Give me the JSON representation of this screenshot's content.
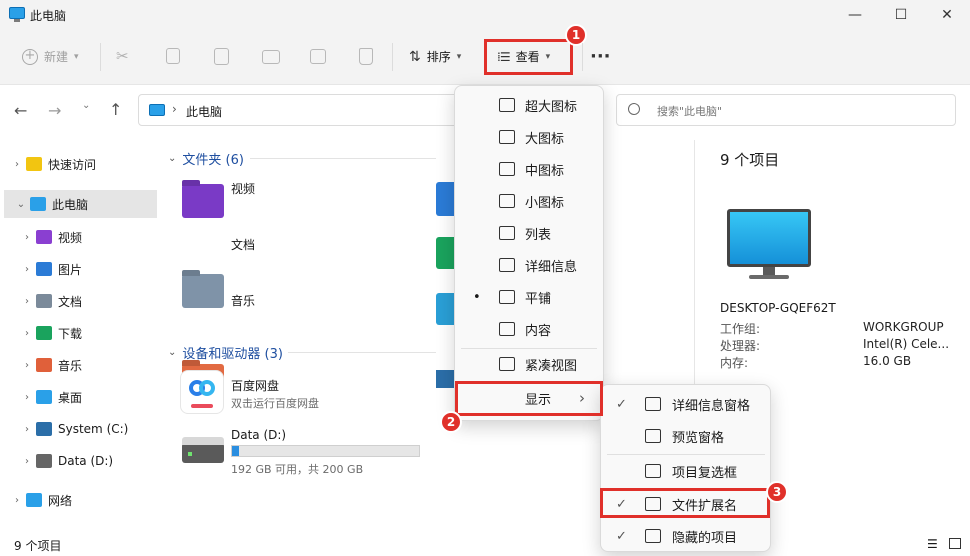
{
  "window": {
    "title": "此电脑",
    "minimize": "—",
    "maximize": "☐",
    "close": "✕"
  },
  "toolbar": {
    "new": "新建",
    "sort": "排序",
    "view": "查看",
    "more": "···"
  },
  "address": {
    "path": "此电脑",
    "search_placeholder": "搜索\"此电脑\""
  },
  "badges": {
    "one": "1",
    "two": "2",
    "three": "3"
  },
  "sidebar": [
    {
      "label": "快速访问",
      "icon": "star-icon",
      "color": "#f2c511"
    },
    {
      "label": "此电脑",
      "icon": "computer-icon",
      "color": "#2aa0e8"
    },
    {
      "label": "视频",
      "icon": "video-icon",
      "color": "#8a3fd1"
    },
    {
      "label": "图片",
      "icon": "picture-icon",
      "color": "#2b7bd6"
    },
    {
      "label": "文档",
      "icon": "document-icon",
      "color": "#7b8a9a"
    },
    {
      "label": "下载",
      "icon": "download-icon",
      "color": "#1aa35d"
    },
    {
      "label": "音乐",
      "icon": "music-icon",
      "color": "#e0603a"
    },
    {
      "label": "桌面",
      "icon": "desktop-icon",
      "color": "#2aa0e8"
    },
    {
      "label": "System (C:)",
      "icon": "windows-drive-icon",
      "color": "#2b6ea8"
    },
    {
      "label": "Data (D:)",
      "icon": "drive-icon",
      "color": "#666666"
    },
    {
      "label": "网络",
      "icon": "network-icon",
      "color": "#2aa0e8"
    }
  ],
  "content": {
    "folders_header": "文件夹 (6)",
    "folders": [
      {
        "label": "视频",
        "color": "#7a3ac6"
      },
      {
        "label": "文档",
        "color": "#7f93a8"
      },
      {
        "label": "音乐",
        "color": "#e26a42"
      }
    ],
    "devices_header": "设备和驱动器 (3)",
    "baidu": {
      "name": "百度网盘",
      "sub": "双击运行百度网盘"
    },
    "drive_d": {
      "name": "Data (D:)",
      "sub": "192 GB 可用，共 200 GB",
      "used_fraction": 0.04
    }
  },
  "details": {
    "count": "9 个项目",
    "computer_name": "DESKTOP-GQEF62T",
    "rows": [
      {
        "key": "工作组:",
        "value": "WORKGROUP"
      },
      {
        "key": "处理器:",
        "value": "Intel(R) Cele..."
      },
      {
        "key": "内存:",
        "value": "16.0 GB"
      }
    ]
  },
  "status": {
    "count": "9 个项目"
  },
  "view_menu": [
    {
      "label": "超大图标",
      "icon": "extra-large-icons-icon"
    },
    {
      "label": "大图标",
      "icon": "large-icons-icon"
    },
    {
      "label": "中图标",
      "icon": "medium-icons-icon"
    },
    {
      "label": "小图标",
      "icon": "small-icons-icon"
    },
    {
      "label": "列表",
      "icon": "list-icon"
    },
    {
      "label": "详细信息",
      "icon": "details-icon"
    },
    {
      "label": "平铺",
      "icon": "tiles-icon"
    },
    {
      "label": "内容",
      "icon": "content-icon"
    },
    {
      "label": "紧凑视图",
      "icon": "compact-view-icon"
    },
    {
      "label": "显示",
      "icon": "show-icon"
    }
  ],
  "show_menu": [
    {
      "label": "详细信息窗格",
      "checked": true
    },
    {
      "label": "预览窗格",
      "checked": false
    },
    {
      "label": "项目复选框",
      "checked": false
    },
    {
      "label": "文件扩展名",
      "checked": true
    },
    {
      "label": "隐藏的项目",
      "checked": true
    }
  ],
  "glyphs": {
    "check": "✓",
    "bullet": "•",
    "arrow": "›",
    "chev_down": "⌄"
  }
}
